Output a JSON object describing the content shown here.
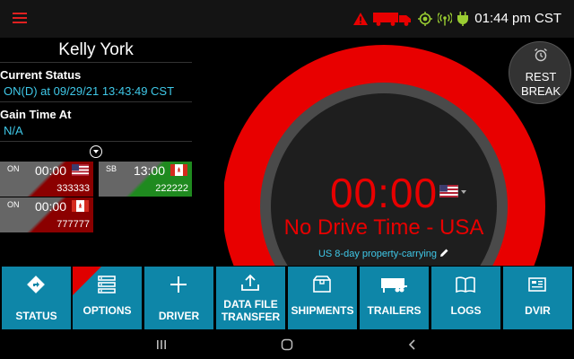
{
  "statusbar": {
    "time": "01:44 pm CST",
    "icons": [
      "warning-icon",
      "truck-icon",
      "gps-icon",
      "signal-icon",
      "power-plug-icon"
    ]
  },
  "driver": {
    "name": "Kelly York",
    "current_status_label": "Current Status",
    "current_status_value": "ON(D) at 09/29/21 13:43:49 CST",
    "gain_time_label": "Gain Time At",
    "gain_time_value": "N/A"
  },
  "clocks": [
    {
      "status": "ON",
      "time": "00:00",
      "flag": "us",
      "value": "333333",
      "color": "#8b0000"
    },
    {
      "status": "SB",
      "time": "13:00",
      "flag": "ca",
      "value": "222222",
      "color": "#1f8a1f"
    },
    {
      "status": "ON",
      "time": "00:00",
      "flag": "ca",
      "value": "777777",
      "color": "#8b0000"
    }
  ],
  "gauge": {
    "timer": "00:00",
    "status_text": "No Drive Time - USA",
    "ruleset": "US 8-day property-carrying",
    "accent_color": "#e80000"
  },
  "rest_break": {
    "line1": "REST",
    "line2": "BREAK"
  },
  "toolbar": {
    "status": "STATUS",
    "options": "OPTIONS",
    "driver": "DRIVER",
    "data_file_line1": "DATA FILE",
    "data_file_line2": "TRANSFER",
    "shipments": "SHIPMENTS",
    "trailers": "TRAILERS",
    "logs": "LOGS",
    "dvir": "DVIR",
    "button_color": "#0e86a8"
  }
}
